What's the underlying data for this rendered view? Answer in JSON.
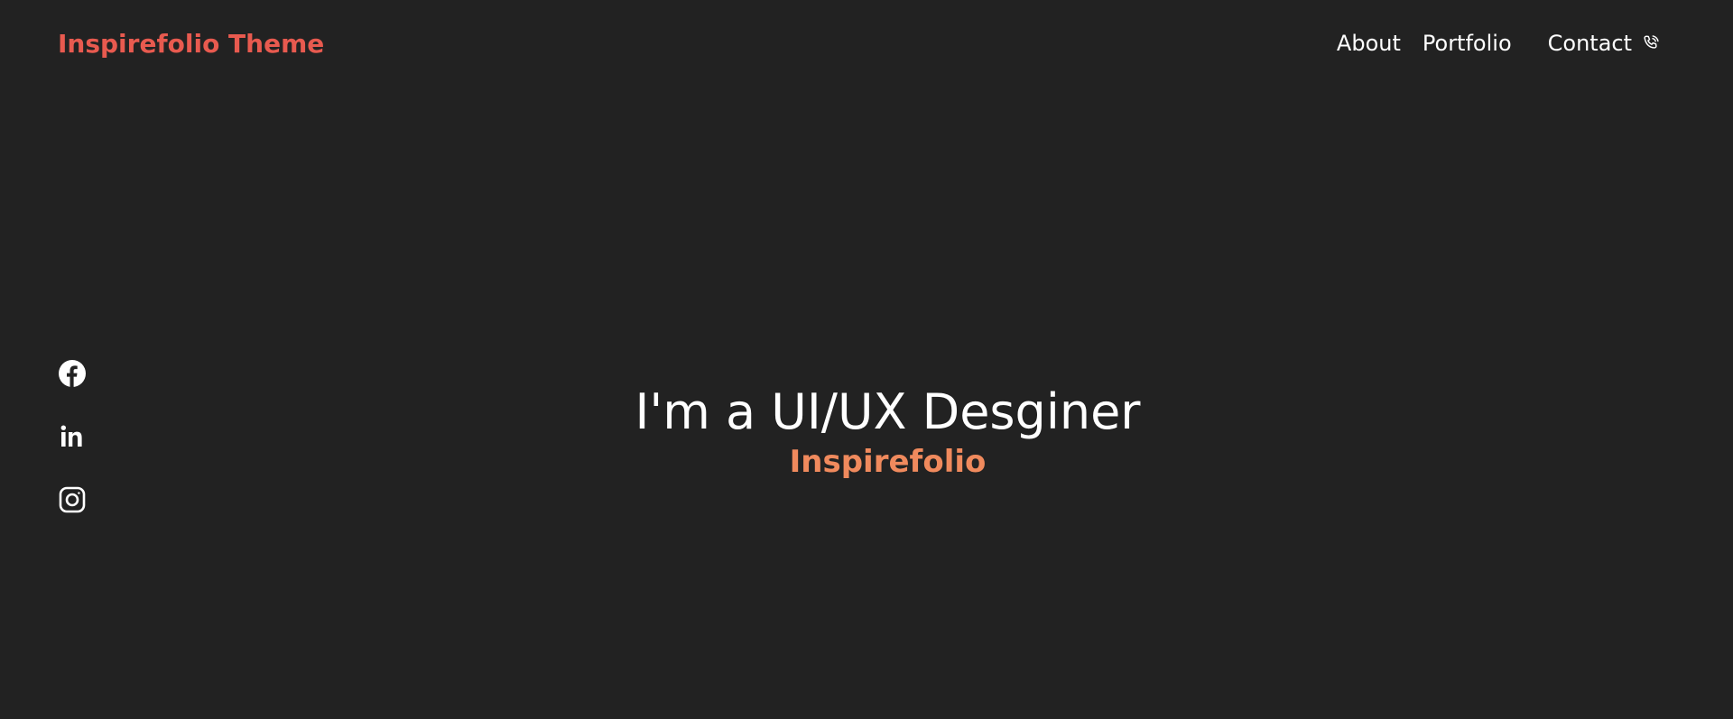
{
  "header": {
    "brand": "Inspirefolio Theme",
    "nav": {
      "about": "About",
      "portfolio": "Portfolio",
      "contact": "Contact"
    }
  },
  "social": {
    "icons": [
      "facebook-icon",
      "linkedin-icon",
      "instagram-icon"
    ]
  },
  "hero": {
    "title": "I'm a UI/UX Desginer",
    "subtitle": "Inspirefolio"
  },
  "colors": {
    "background": "#222222",
    "brand": "#e85a4f",
    "accent": "#f08a5d",
    "text": "#ffffff"
  }
}
